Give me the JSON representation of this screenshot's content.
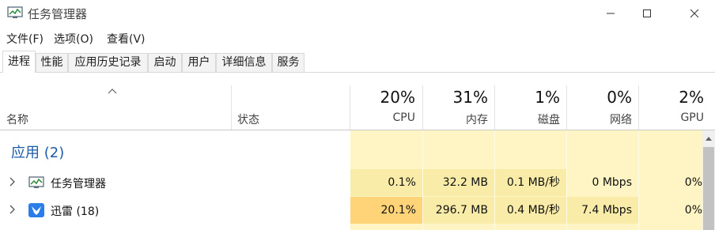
{
  "window": {
    "title": "任务管理器"
  },
  "menu": [
    {
      "label": "文件(F)"
    },
    {
      "label": "选项(O)"
    },
    {
      "label": "查看(V)"
    }
  ],
  "tabs": [
    {
      "label": "进程",
      "active": true
    },
    {
      "label": "性能"
    },
    {
      "label": "应用历史记录"
    },
    {
      "label": "启动"
    },
    {
      "label": "用户"
    },
    {
      "label": "详细信息"
    },
    {
      "label": "服务"
    }
  ],
  "columns": {
    "name": {
      "label": "名称"
    },
    "status": {
      "label": "状态"
    },
    "cpu": {
      "label": "CPU",
      "percent": "20%"
    },
    "memory": {
      "label": "内存",
      "percent": "31%"
    },
    "disk": {
      "label": "磁盘",
      "percent": "1%"
    },
    "network": {
      "label": "网络",
      "percent": "0%"
    },
    "gpu": {
      "label": "GPU",
      "percent": "2%"
    }
  },
  "group": {
    "label": "应用 (2)"
  },
  "rows": [
    {
      "name": "任务管理器",
      "icon": "task-manager-icon",
      "cpu": "0.1%",
      "memory": "32.2 MB",
      "disk": "0.1 MB/秒",
      "network": "0 Mbps",
      "gpu": "0%"
    },
    {
      "name": "迅雷 (18)",
      "icon": "xunlei-icon",
      "cpu": "20.1%",
      "memory": "296.7 MB",
      "disk": "0.4 MB/秒",
      "network": "7.4 Mbps",
      "gpu": "0%"
    }
  ],
  "colors": {
    "usage_light": "#fff4c4",
    "usage_mid": "#f9eca8",
    "usage_high": "#ffd479",
    "group_text": "#1c5ba8"
  }
}
